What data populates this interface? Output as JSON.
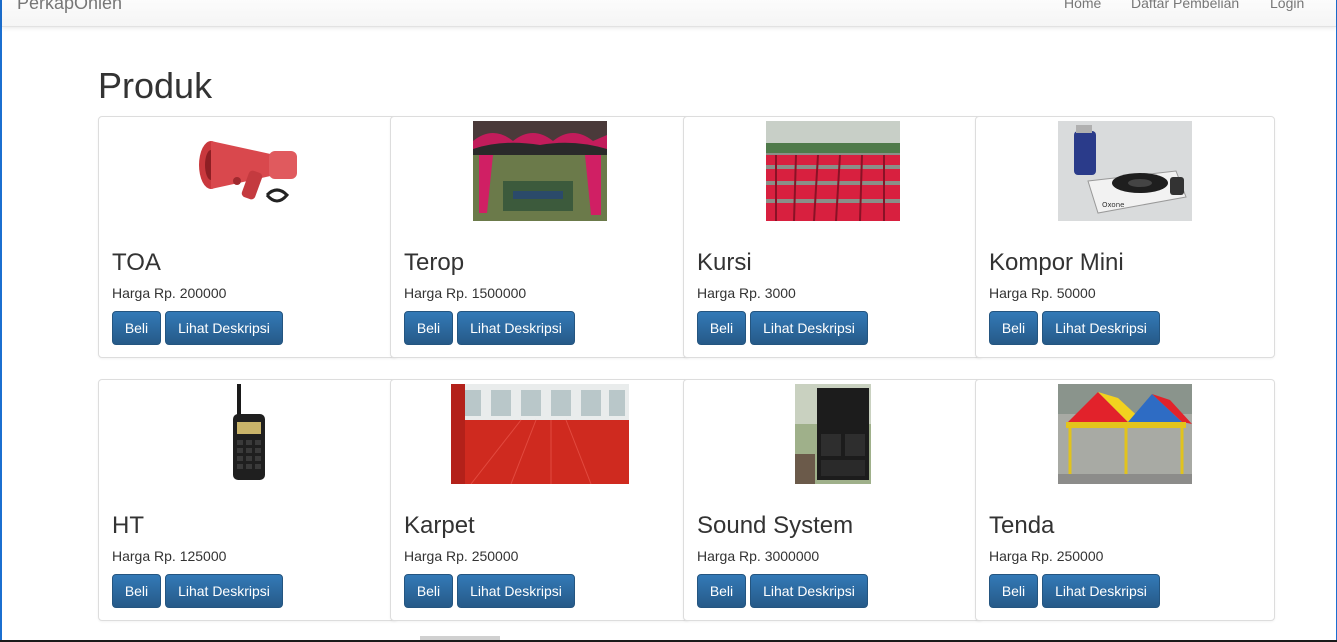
{
  "navbar": {
    "brand": "PerkapOnlen",
    "links": [
      "Home",
      "Daftar Pembelian",
      "Login"
    ]
  },
  "page": {
    "title": "Produk"
  },
  "products": [
    {
      "name": "TOA",
      "price": "Harga Rp. 200000",
      "buy_label": "Beli",
      "desc_label": "Lihat Deskripsi",
      "icon": "megaphone-icon"
    },
    {
      "name": "Terop",
      "price": "Harga Rp. 1500000",
      "buy_label": "Beli",
      "desc_label": "Lihat Deskripsi",
      "icon": "canopy-icon"
    },
    {
      "name": "Kursi",
      "price": "Harga Rp. 3000",
      "buy_label": "Beli",
      "desc_label": "Lihat Deskripsi",
      "icon": "chairs-icon"
    },
    {
      "name": "Kompor Mini",
      "price": "Harga Rp. 50000",
      "buy_label": "Beli",
      "desc_label": "Lihat Deskripsi",
      "icon": "stove-icon"
    },
    {
      "name": "HT",
      "price": "Harga Rp. 125000",
      "buy_label": "Beli",
      "desc_label": "Lihat Deskripsi",
      "icon": "radio-icon"
    },
    {
      "name": "Karpet",
      "price": "Harga Rp. 250000",
      "buy_label": "Beli",
      "desc_label": "Lihat Deskripsi",
      "icon": "carpet-icon"
    },
    {
      "name": "Sound System",
      "price": "Harga Rp. 3000000",
      "buy_label": "Beli",
      "desc_label": "Lihat Deskripsi",
      "icon": "speaker-icon"
    },
    {
      "name": "Tenda",
      "price": "Harga Rp. 250000",
      "buy_label": "Beli",
      "desc_label": "Lihat Deskripsi",
      "icon": "tent-icon"
    }
  ],
  "colors": {
    "primary": "#337ab7",
    "primary_dark": "#265a88",
    "text": "#333333",
    "nav_text": "#777777"
  }
}
